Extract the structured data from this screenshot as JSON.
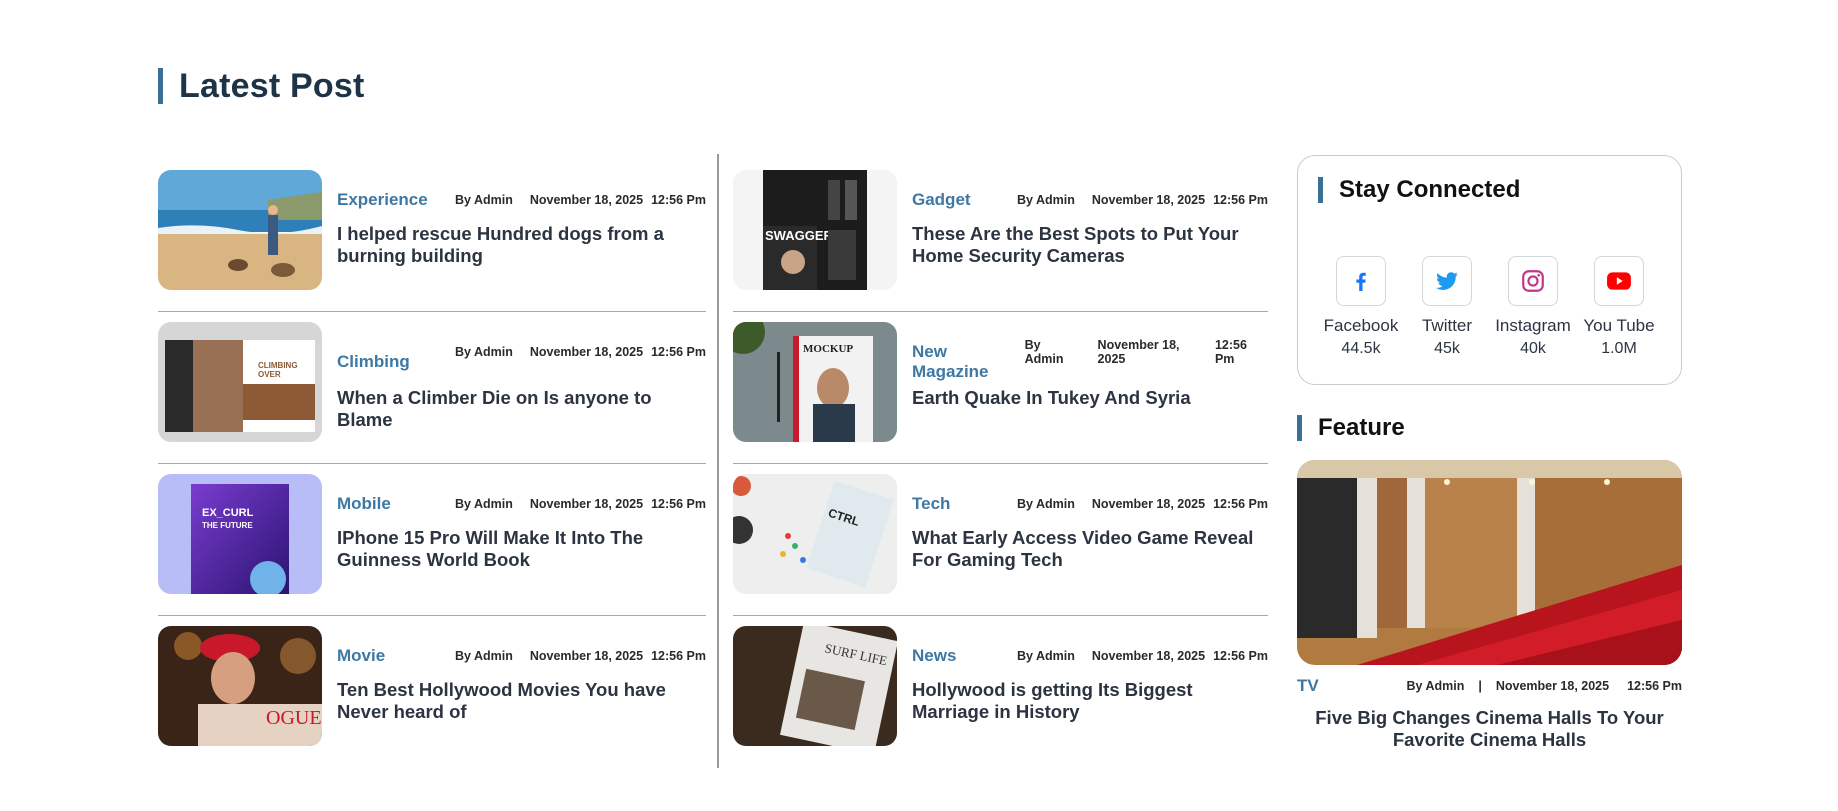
{
  "section_title": "Latest Post",
  "left_posts": [
    {
      "category": "Experience",
      "author": "By Admin",
      "date": "November 18, 2025",
      "time": "12:56 Pm",
      "title": "I helped rescue Hundred dogs from a burning building"
    },
    {
      "category": "Climbing",
      "author": "By Admin",
      "date": "November 18, 2025",
      "time": "12:56 Pm",
      "title": "When a Climber Die on Is anyone to Blame"
    },
    {
      "category": "Mobile",
      "author": "By Admin",
      "date": "November 18, 2025",
      "time": "12:56 Pm",
      "title": "IPhone 15 Pro Will Make It Into The Guinness World Book"
    },
    {
      "category": "Movie",
      "author": "By Admin",
      "date": "November 18, 2025",
      "time": "12:56 Pm",
      "title": "Ten Best Hollywood Movies You have Never heard of"
    }
  ],
  "mid_posts": [
    {
      "category": "Gadget",
      "author": "By Admin",
      "date": "November 18, 2025",
      "time": "12:56 Pm",
      "title": "These Are the Best Spots to Put Your Home Security Cameras"
    },
    {
      "category": "New Magazine",
      "author": "By Admin",
      "date": "November 18, 2025",
      "time": "12:56 Pm",
      "title": "Earth Quake In Tukey And Syria"
    },
    {
      "category": "Tech",
      "author": "By Admin",
      "date": "November 18, 2025",
      "time": "12:56 Pm",
      "title": "What Early Access Video Game Reveal For Gaming Tech"
    },
    {
      "category": "News",
      "author": "By Admin",
      "date": "November 18, 2025",
      "time": "12:56 Pm",
      "title": "Hollywood is getting Its Biggest Marriage in History"
    }
  ],
  "stay_connected": {
    "title": "Stay Connected",
    "items": [
      {
        "name": "Facebook",
        "count": "44.5k",
        "icon": "facebook-icon",
        "color": "#1877f2"
      },
      {
        "name": "Twitter",
        "count": "45k",
        "icon": "twitter-icon",
        "color": "#1d9bf0"
      },
      {
        "name": "Instagram",
        "count": "40k",
        "icon": "instagram-icon",
        "color": "#c1358a"
      },
      {
        "name": "You Tube",
        "count": "1.0M",
        "icon": "youtube-icon",
        "color": "#ff0000"
      }
    ]
  },
  "feature": {
    "title": "Feature",
    "category": "TV",
    "author": "By Admin",
    "separator": "|",
    "date": "November 18, 2025",
    "time": "12:56 Pm",
    "headline": "Five Big Changes Cinema Halls To Your Favorite Cinema Halls"
  },
  "colors": {
    "accent": "#3a6f96",
    "category": "#3e78a3"
  }
}
